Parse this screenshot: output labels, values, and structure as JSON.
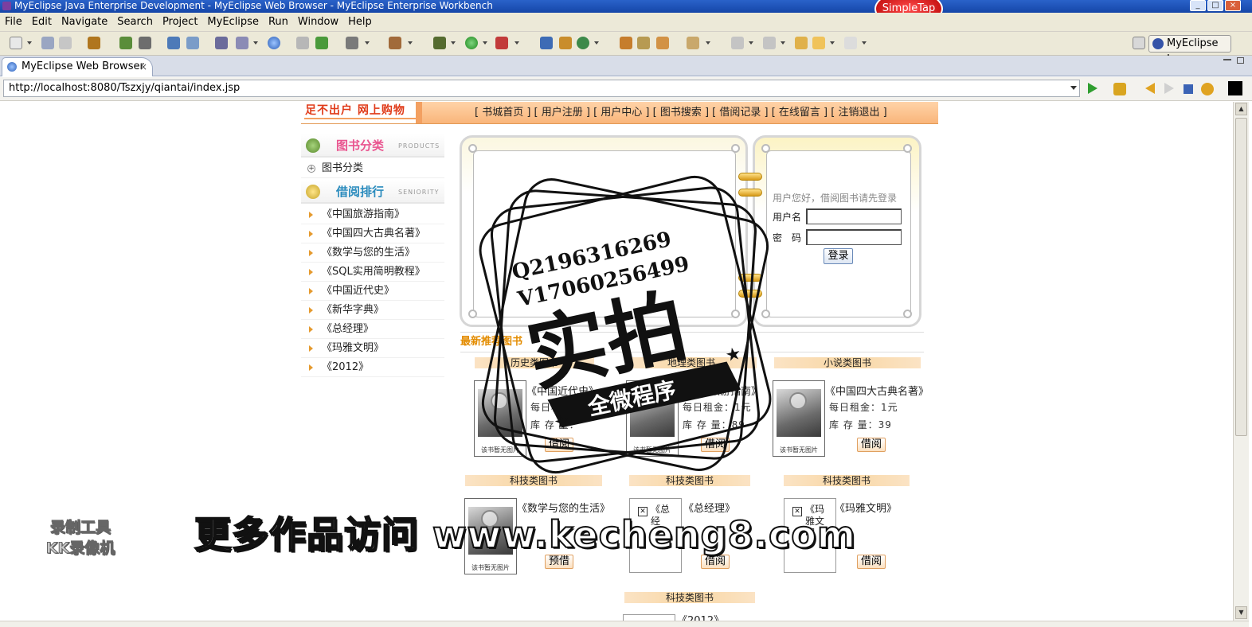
{
  "window": {
    "title": "MyEclipse Java Enterprise Development - MyEclipse Web Browser - MyEclipse Enterprise Workbench",
    "badge": "SimpleTap",
    "min": "_",
    "max": "□",
    "close": "×"
  },
  "menu": [
    "File",
    "Edit",
    "Navigate",
    "Search",
    "Project",
    "MyEclipse",
    "Run",
    "Window",
    "Help"
  ],
  "perspective": {
    "label": "MyEclipse J..."
  },
  "browser_tab": {
    "label": "MyEclipse Web Browser",
    "close": "×"
  },
  "address": {
    "url": "http://localhost:8080/Tszxjy/qiantai/index.jsp"
  },
  "site": {
    "logo": "足不出户  网上购物",
    "nav": "[ 书城首页 ] [ 用户注册 ] [ 用户中心 ] [ 图书搜索 ] [ 借阅记录 ] [ 在线留言 ] [ 注销退出 ]",
    "category_section": {
      "title": "图书分类",
      "en": "PRODUCTS",
      "item": "图书分类"
    },
    "rank_section": {
      "title": "借阅排行",
      "en": "SENIORITY",
      "items": [
        "《中国旅游指南》",
        "《中国四大古典名著》",
        "《数学与您的生活》",
        "《SQL实用简明教程》",
        "《中国近代史》",
        "《新华字典》",
        "《总经理》",
        "《玛雅文明》",
        "《2012》"
      ]
    },
    "login": {
      "hint": "用户您好，借阅图书请先登录",
      "username_label": "用户名",
      "password_label": "密　码",
      "button": "登录"
    },
    "recommended": {
      "title": "最新推荐图书",
      "cover_caption": "该书暂无图片",
      "rows": [
        [
          {
            "category": "历史类图书",
            "title": "《中国近代史》",
            "rent": "每日租金：",
            "stock": "库 存 量：",
            "action": "借阅"
          },
          {
            "category": "地理类图书",
            "title": "《中国旅游指南》",
            "rent": "每日租金：1元",
            "stock": "库 存 量：89",
            "action": "借阅"
          },
          {
            "category": "小说类图书",
            "title": "《中国四大古典名著》",
            "rent": "每日租金：1元",
            "stock": "库 存 量：39",
            "action": "借阅"
          }
        ],
        [
          {
            "category": "科技类图书",
            "title": "《数学与您的生活》",
            "action": "预借"
          },
          {
            "category": "科技类图书",
            "title": "《总经理》",
            "alt": "《总经",
            "action": "借阅"
          },
          {
            "category": "科技类图书",
            "title": "《玛雅文明》",
            "alt": "《玛雅文明",
            "action": "借阅"
          }
        ],
        [
          {
            "category": "科技类图书",
            "title": "《2012》"
          }
        ]
      ]
    }
  },
  "watermarks": {
    "qq": "Q2196316269",
    "vx": "V17060256499",
    "big": "实拍",
    "ribbon": "全微程序",
    "site": "更多作品访问 www.kecheng8.com",
    "recorder_line1": "录制工具",
    "recorder_line2": "KK录像机"
  },
  "colors": {
    "accent": "#f3a061",
    "title_bar": "#1546a8",
    "rank_orange": "#e38c00"
  }
}
